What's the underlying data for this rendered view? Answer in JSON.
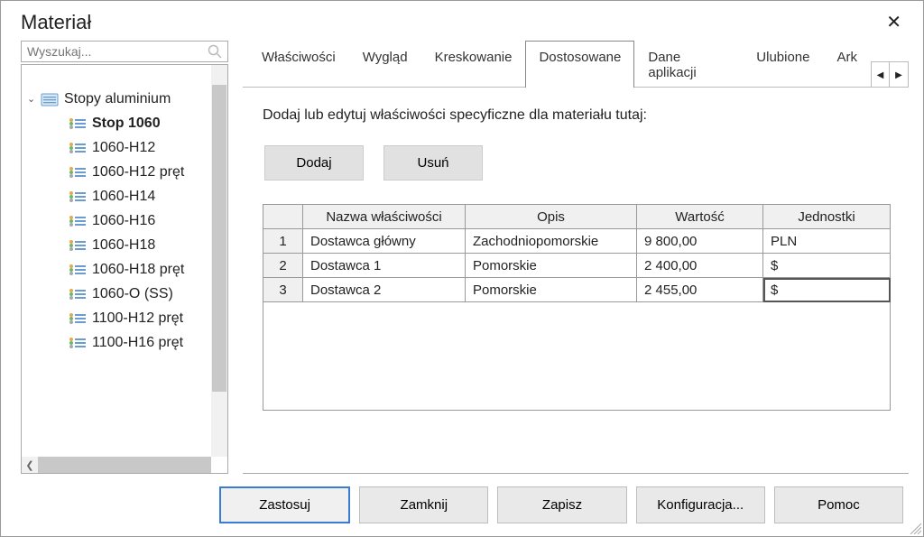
{
  "window": {
    "title": "Materiał"
  },
  "search": {
    "placeholder": "Wyszukaj..."
  },
  "tree": {
    "root_label": "Stopy aluminium",
    "items": [
      {
        "label": "Stop 1060",
        "selected": true
      },
      {
        "label": "1060-H12",
        "selected": false
      },
      {
        "label": "1060-H12 pręt",
        "selected": false
      },
      {
        "label": "1060-H14",
        "selected": false
      },
      {
        "label": "1060-H16",
        "selected": false
      },
      {
        "label": "1060-H18",
        "selected": false
      },
      {
        "label": "1060-H18 pręt",
        "selected": false
      },
      {
        "label": "1060-O (SS)",
        "selected": false
      },
      {
        "label": "1100-H12 pręt",
        "selected": false
      },
      {
        "label": "1100-H16 pręt",
        "selected": false
      }
    ]
  },
  "tabs": {
    "items": [
      {
        "label": "Właściwości",
        "active": false
      },
      {
        "label": "Wygląd",
        "active": false
      },
      {
        "label": "Kreskowanie",
        "active": false
      },
      {
        "label": "Dostosowane",
        "active": true
      },
      {
        "label": "Dane aplikacji",
        "active": false
      },
      {
        "label": "Ulubione",
        "active": false
      },
      {
        "label": "Ark",
        "active": false
      }
    ]
  },
  "panel": {
    "instruction": "Dodaj lub edytuj właściwości specyficzne dla materiału tutaj:",
    "add_label": "Dodaj",
    "remove_label": "Usuń",
    "headers": {
      "name": "Nazwa właściwości",
      "desc": "Opis",
      "value": "Wartość",
      "unit": "Jednostki"
    },
    "rows": [
      {
        "num": "1",
        "name": "Dostawca główny",
        "desc": "Zachodniopomorskie",
        "value": "9 800,00",
        "unit": "PLN"
      },
      {
        "num": "2",
        "name": "Dostawca 1",
        "desc": "Pomorskie",
        "value": "2 400,00",
        "unit": "$"
      },
      {
        "num": "3",
        "name": "Dostawca 2",
        "desc": "Pomorskie",
        "value": "2 455,00",
        "unit": "$"
      }
    ]
  },
  "footer": {
    "apply": "Zastosuj",
    "close": "Zamknij",
    "save": "Zapisz",
    "config": "Konfiguracja...",
    "help": "Pomoc"
  }
}
